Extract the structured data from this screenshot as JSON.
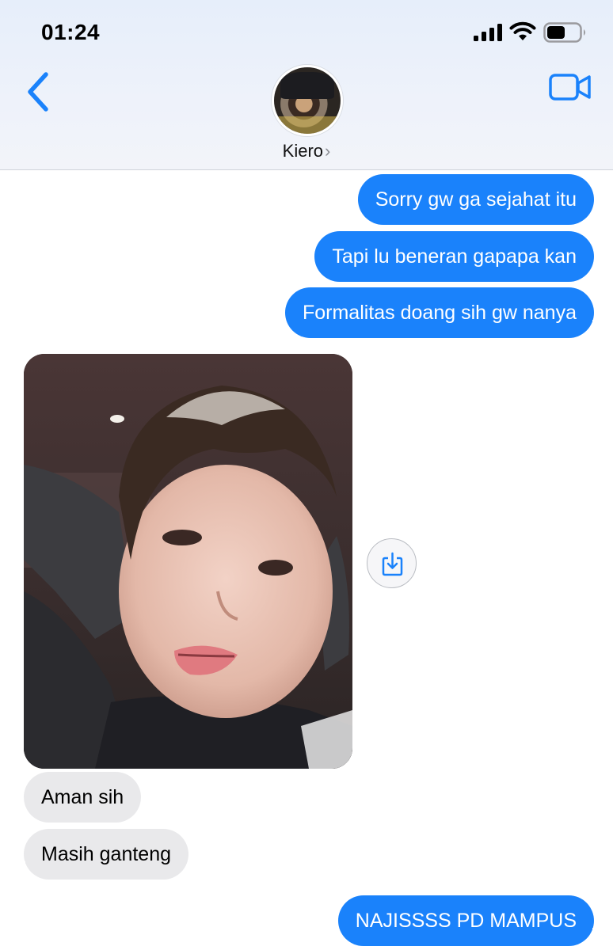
{
  "status_bar": {
    "time": "01:24"
  },
  "header": {
    "contact_name": "Kiero",
    "chevron": "›",
    "back_icon": "chevron-left-icon",
    "video_icon": "video-camera-icon"
  },
  "colors": {
    "outgoing_bubble": "#1a82fb",
    "incoming_bubble": "#e9e9eb",
    "accent": "#1a82fb"
  },
  "messages": [
    {
      "direction": "outgoing",
      "text": "Sorry gw ga sejahat itu"
    },
    {
      "direction": "outgoing",
      "text": "Tapi lu beneran gapapa kan"
    },
    {
      "direction": "outgoing",
      "text": "Formalitas doang sih gw nanya"
    },
    {
      "direction": "incoming",
      "type": "photo"
    },
    {
      "direction": "incoming",
      "text": "Aman sih"
    },
    {
      "direction": "incoming",
      "text": "Masih ganteng"
    },
    {
      "direction": "outgoing",
      "text": "NAJISSSS PD MAMPUS"
    }
  ]
}
